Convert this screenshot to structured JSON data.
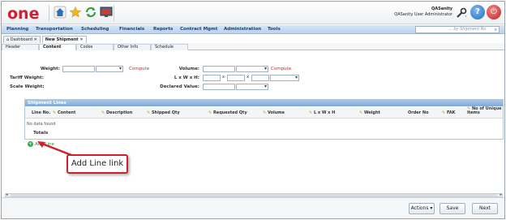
{
  "header": {
    "logo_text": "one",
    "user_name": "QASanity",
    "user_role": "QASanity User Administrator"
  },
  "icons": [
    "home-icon",
    "star-icon",
    "refresh-icon",
    "monitor-icon",
    "wrench-icon",
    "help-icon",
    "power-icon"
  ],
  "colors": {
    "accent": "#d01f2f",
    "nav": "#1d3f6b",
    "panel_header": "#7fa9d6",
    "add_link": "#2d8a3b"
  },
  "nav": {
    "items": [
      "Planning",
      "Transportation",
      "Scheduling",
      "Financials",
      "Reports",
      "Contract Mgmt",
      "Administration",
      "Tools"
    ],
    "search_placeholder": "... by Shipment No"
  },
  "doc_tabs": [
    "Dashboard",
    "New Shipment"
  ],
  "sub_tabs": [
    "Header",
    "Content",
    "Codes",
    "Other Info",
    "Schedule"
  ],
  "form": {
    "weight_label": "Weight:",
    "tariff_weight_label": "Tariff Weight:",
    "scale_weight_label": "Scale Weight:",
    "compute_label": "Compute",
    "volume_label": "Volume:",
    "lwh_label": "L x W x H:",
    "declared_value_label": "Declared Value:",
    "x_mark": "x"
  },
  "shipment_lines": {
    "title": "Shipment Lines",
    "columns": [
      "Line No.",
      "Content",
      "Description",
      "Shipped Qty",
      "Requested Qty",
      "Volume",
      "L x W x H",
      "Weight",
      "Order No",
      "FAK",
      "No of Unique Items"
    ],
    "no_data": "No data found",
    "totals_label": "Totals"
  },
  "add_line_label": "Add Line",
  "callout_text": "Add Line link",
  "footer": {
    "actions_label": "Actions",
    "save_label": "Save",
    "next_label": "Next"
  }
}
